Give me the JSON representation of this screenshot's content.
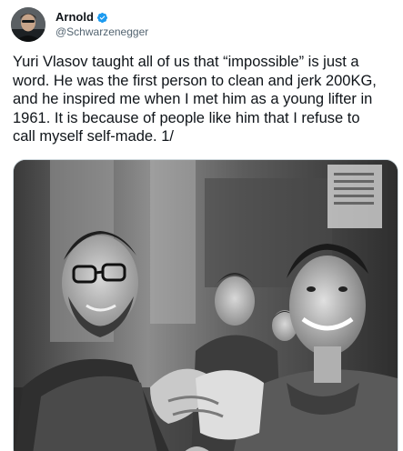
{
  "author": {
    "display_name": "Arnold",
    "handle": "@Schwarzenegger",
    "verified": true,
    "avatar_icon": "avatar-photo",
    "verified_icon": "verified-badge-icon",
    "verified_color": "#1d9bf0"
  },
  "tweet": {
    "text": "Yuri Vlasov taught all of us that “impossible” is just a\nword. He was the first person to clean and jerk 200KG,\nand he inspired me when I met him as a young lifter in\n1961. It is because of people like him that I refuse to\ncall myself self-made. 1/"
  },
  "media": {
    "type": "photo",
    "style": "black-and-white",
    "poster_text": ""
  },
  "colors": {
    "text_primary": "#0f1419",
    "text_secondary": "#536471",
    "accent": "#1d9bf0",
    "border": "#cfd9de"
  }
}
